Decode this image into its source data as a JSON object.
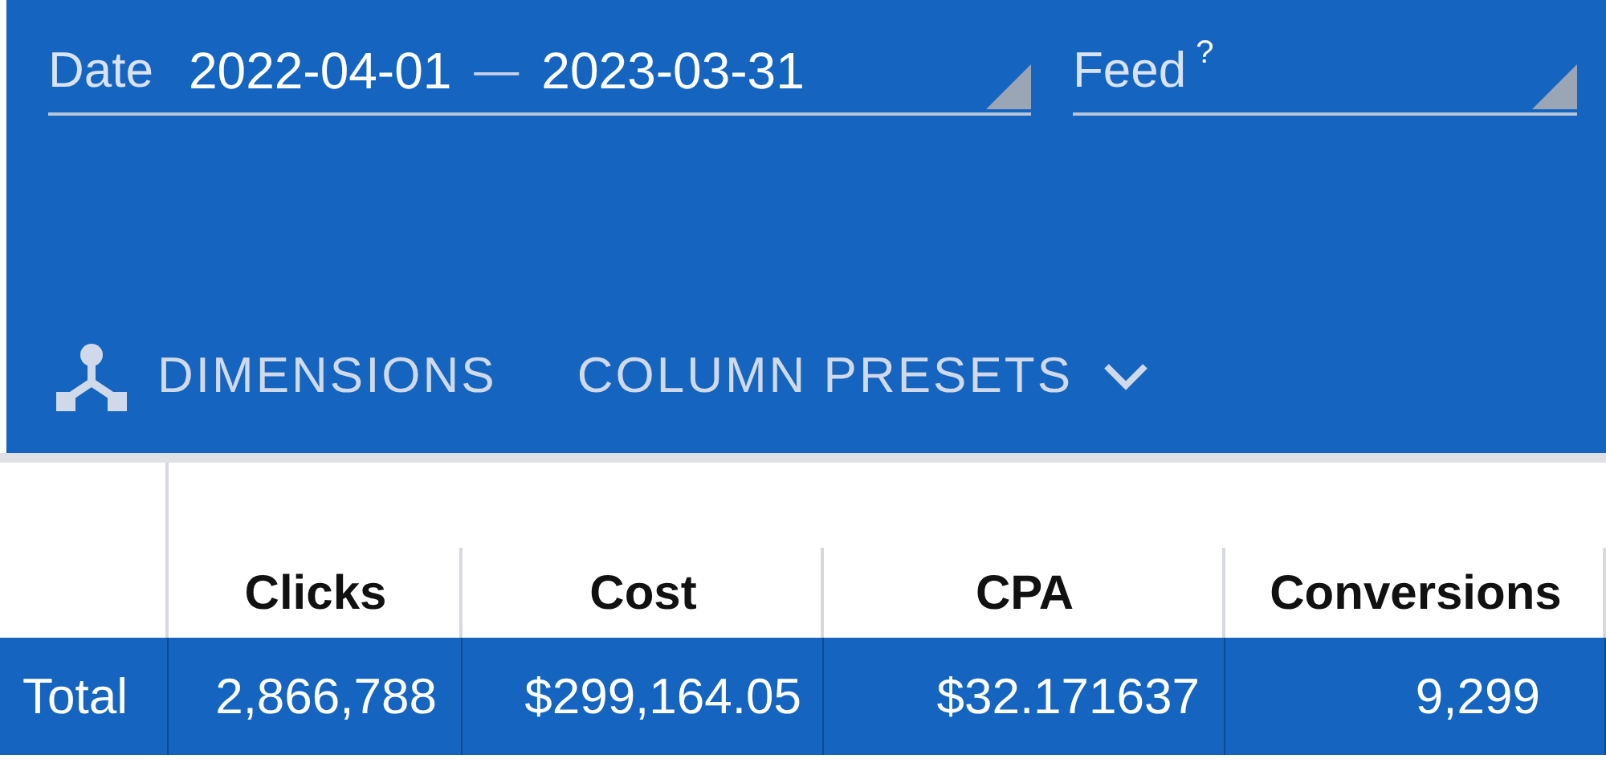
{
  "filters": [
    {
      "kind": "range",
      "label": "Date",
      "start": "2022-04-01",
      "separator": "—",
      "end": "2023-03-31"
    },
    {
      "kind": "select",
      "label": "Feed",
      "help": "?"
    }
  ],
  "toolbar": [
    {
      "kind": "dimensions",
      "label": "DIMENSIONS"
    },
    {
      "kind": "presets",
      "label": "COLUMN PRESETS"
    }
  ],
  "table": {
    "columns": [
      "Clicks",
      "Cost",
      "CPA",
      "Conversions"
    ],
    "total_row": {
      "label": "Total",
      "cells": [
        "2,866,788",
        "$299,164.05",
        "$32.171637",
        "9,299"
      ]
    }
  }
}
